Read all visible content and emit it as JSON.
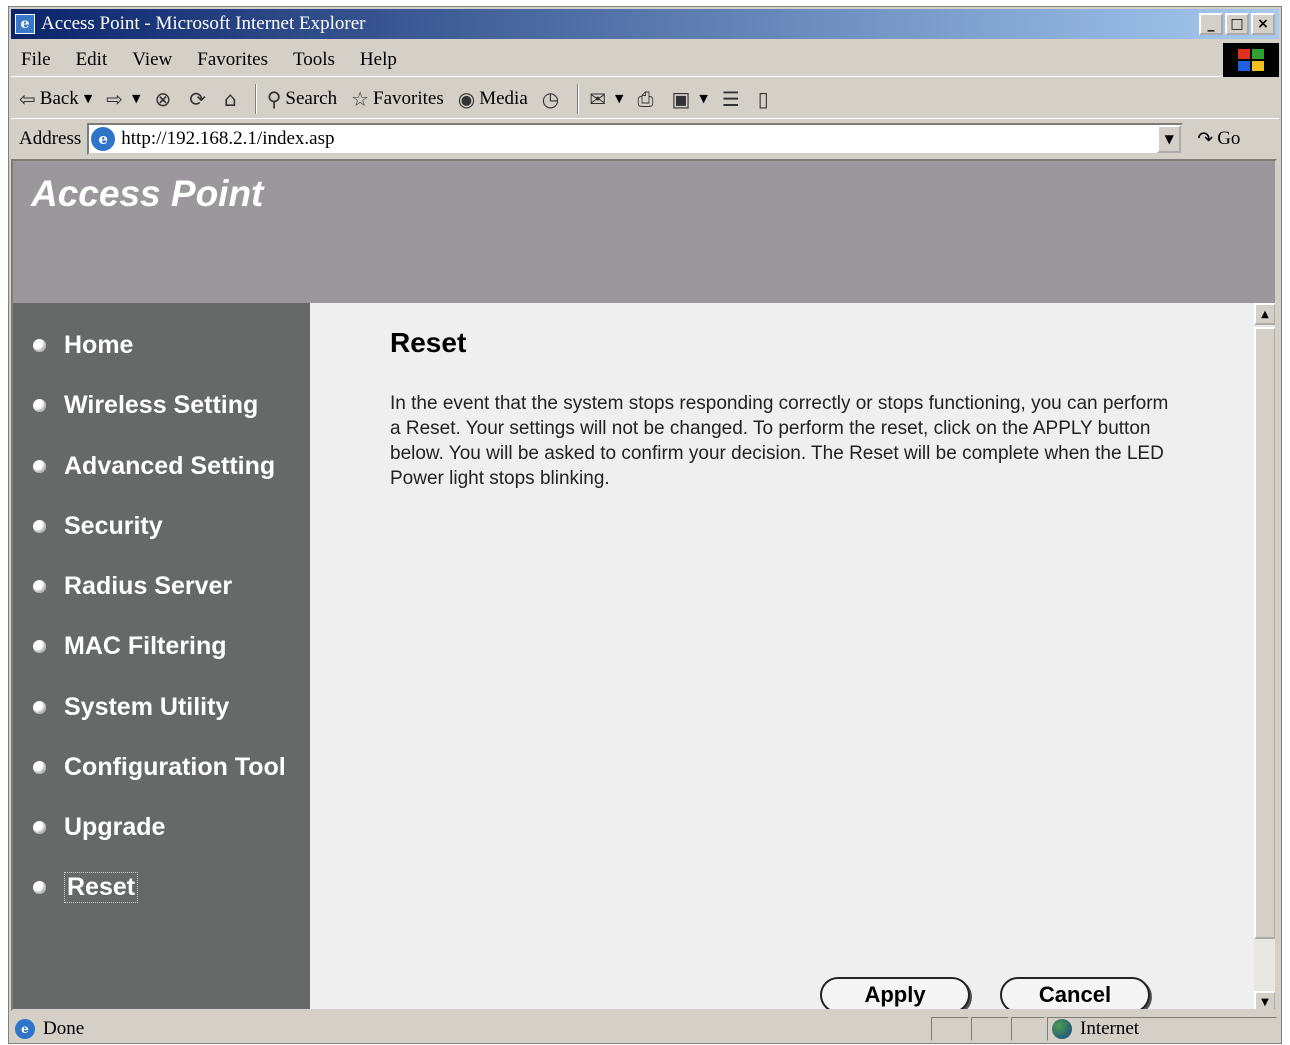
{
  "window": {
    "title": "Access Point - Microsoft Internet Explorer",
    "minimize": "_",
    "maximize": "□",
    "close": "×"
  },
  "menubar": [
    "File",
    "Edit",
    "View",
    "Favorites",
    "Tools",
    "Help"
  ],
  "toolbar": {
    "back": "Back",
    "search": "Search",
    "favorites": "Favorites",
    "media": "Media"
  },
  "address": {
    "label": "Address",
    "url": "http://192.168.2.1/index.asp",
    "go": "Go"
  },
  "banner": {
    "title": "Access Point"
  },
  "sidebar": {
    "items": [
      {
        "label": "Home"
      },
      {
        "label": "Wireless Setting"
      },
      {
        "label": "Advanced Setting"
      },
      {
        "label": "Security"
      },
      {
        "label": "Radius Server"
      },
      {
        "label": "MAC Filtering"
      },
      {
        "label": "System Utility"
      },
      {
        "label": "Configuration Tool"
      },
      {
        "label": "Upgrade"
      },
      {
        "label": "Reset"
      }
    ],
    "active": "Reset"
  },
  "main": {
    "heading": "Reset",
    "description": "In the event that the system stops responding correctly or stops functioning, you can perform a Reset. Your settings will not be changed. To perform the reset, click on the APPLY button below. You will be asked to confirm your decision. The Reset will be complete when the LED Power light stops blinking.",
    "apply_label": "Apply",
    "cancel_label": "Cancel"
  },
  "statusbar": {
    "status": "Done",
    "zone": "Internet"
  }
}
